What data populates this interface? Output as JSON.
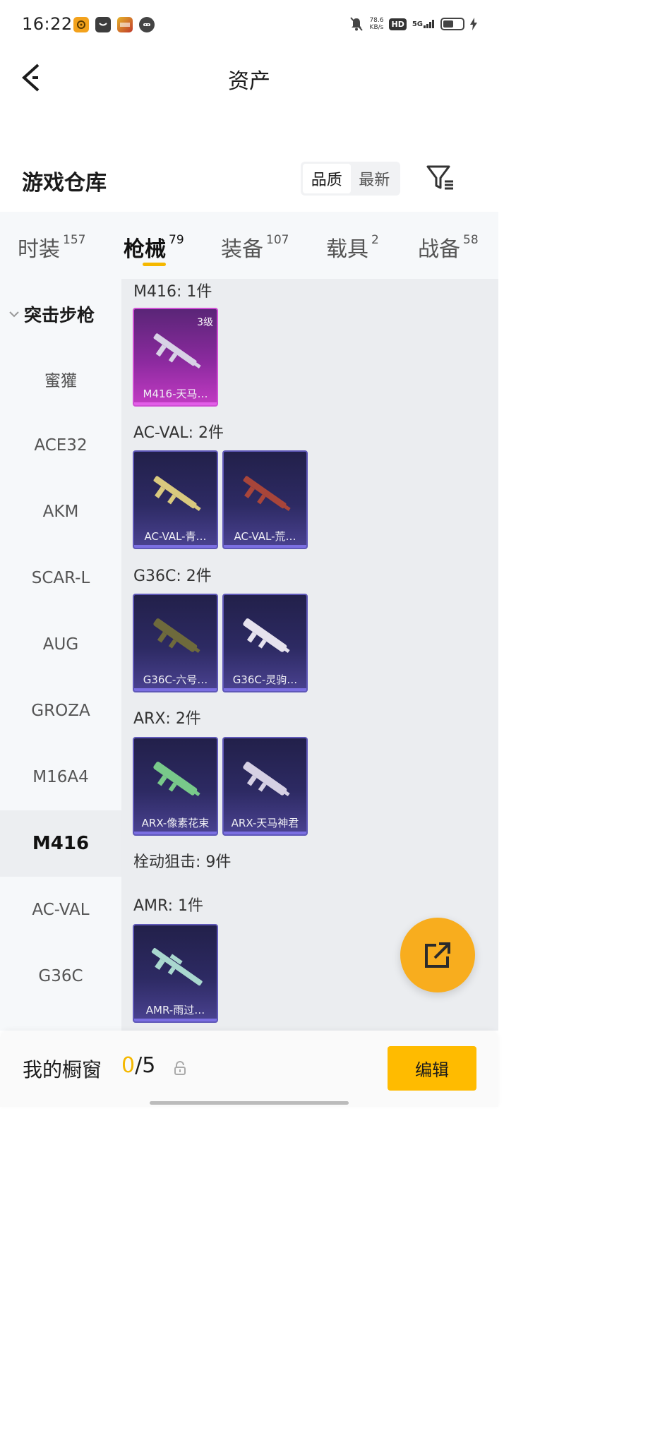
{
  "status_bar": {
    "time": "16:22",
    "net_speed_value": "78.6",
    "net_speed_unit": "KB/s",
    "hd": "HD",
    "network": "5G"
  },
  "header": {
    "title": "资产"
  },
  "warehouse": {
    "title": "游戏仓库",
    "sort_options": [
      {
        "label": "品质",
        "selected": true
      },
      {
        "label": "最新",
        "selected": false
      }
    ]
  },
  "tabs": [
    {
      "label": "时装",
      "count": "157"
    },
    {
      "label": "枪械",
      "count": "79",
      "active": true
    },
    {
      "label": "装备",
      "count": "107"
    },
    {
      "label": "载具",
      "count": "2"
    },
    {
      "label": "战备",
      "count": "58"
    }
  ],
  "sidebar": {
    "group_label": "突击步枪",
    "items": [
      "蜜獾",
      "ACE32",
      "AKM",
      "SCAR-L",
      "AUG",
      "GROZA",
      "M16A4",
      "M416",
      "AC-VAL",
      "G36C"
    ],
    "active": "M416"
  },
  "groups": [
    {
      "label": "M416: 1件",
      "items": [
        {
          "name": "M416-天马…",
          "level": "3级",
          "rarity": "purple",
          "color": "#d8d2e6"
        }
      ]
    },
    {
      "label": "AC-VAL: 2件",
      "items": [
        {
          "name": "AC-VAL-青…",
          "rarity": "blue",
          "color": "#d9c97e"
        },
        {
          "name": "AC-VAL-荒…",
          "rarity": "blue",
          "color": "#a8453a"
        }
      ]
    },
    {
      "label": "G36C: 2件",
      "items": [
        {
          "name": "G36C-六号…",
          "rarity": "blue",
          "color": "#6e6a3c"
        },
        {
          "name": "G36C-灵驹…",
          "rarity": "blue",
          "color": "#e6e2ee"
        }
      ]
    },
    {
      "label": "ARX: 2件",
      "items": [
        {
          "name": "ARX-像素花束",
          "rarity": "blue",
          "color": "#78c98a"
        },
        {
          "name": "ARX-天马神君",
          "rarity": "blue",
          "color": "#d6d0e4"
        }
      ]
    },
    {
      "label": "栓动狙击: 9件",
      "items": []
    },
    {
      "label": "AMR: 1件",
      "items": [
        {
          "name": "AMR-雨过…",
          "rarity": "blue",
          "color": "#a9d8cf"
        }
      ]
    }
  ],
  "bottom_bar": {
    "label": "我的橱窗",
    "current": "0",
    "total": "/5",
    "edit_label": "编辑"
  },
  "colors": {
    "accent": "#ffbb00",
    "fab": "#f8ad1e",
    "purple_rarity": "#c23bc3",
    "blue_rarity": "#4a4291"
  }
}
